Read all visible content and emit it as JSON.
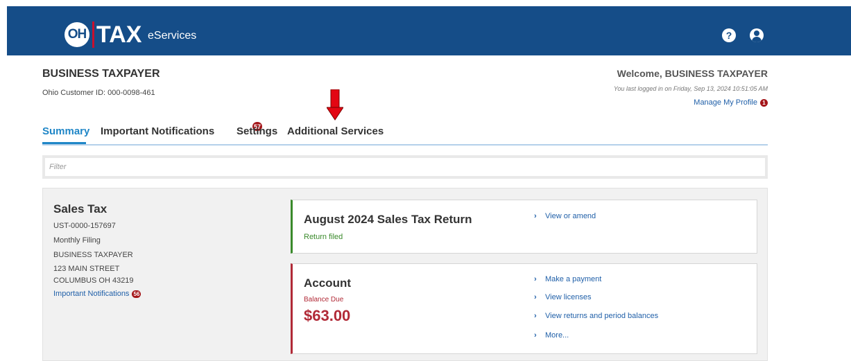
{
  "header": {
    "logo_oh": "OH",
    "logo_tax": "TAX",
    "logo_eservices": "eServices",
    "help_icon_glyph": "?",
    "brand_color": "#154d88"
  },
  "taxpayer": {
    "name": "BUSINESS TAXPAYER",
    "customer_id": "Ohio Customer ID: 000-0098-461"
  },
  "user": {
    "welcome": "Welcome, BUSINESS TAXPAYER",
    "last_login": "You last logged in on Friday, Sep 13, 2024 10:51:05 AM",
    "manage_profile": "Manage My Profile",
    "profile_badge": "1"
  },
  "tabs": [
    {
      "label": "Summary",
      "active": true
    },
    {
      "label": "Important Notifications",
      "badge": "57"
    },
    {
      "label": "Settings"
    },
    {
      "label": "Additional Services"
    }
  ],
  "filter": {
    "placeholder": "Filter"
  },
  "account": {
    "title": "Sales Tax",
    "number": "UST-0000-157697",
    "filing": "Monthly Filing",
    "name": "BUSINESS TAXPAYER",
    "address1": "123 MAIN STREET",
    "address2": "COLUMBUS OH 43219",
    "notifications_link": "Important Notifications",
    "notifications_badge": "56"
  },
  "return_card": {
    "title": "August 2024 Sales Tax Return",
    "status": "Return filed",
    "links": [
      "View or amend"
    ]
  },
  "account_card": {
    "title": "Account",
    "balance_label": "Balance Due",
    "balance": "$63.00",
    "links": [
      "Make a payment",
      "View licenses",
      "View returns and period balances",
      "More..."
    ]
  },
  "colors": {
    "accent_blue": "#1f86c7",
    "link_blue": "#1f5fa8",
    "alert_red": "#b12a37",
    "success_green": "#3a8a2b",
    "badge_red": "#a4161a",
    "arrow_red": "#e30613"
  }
}
